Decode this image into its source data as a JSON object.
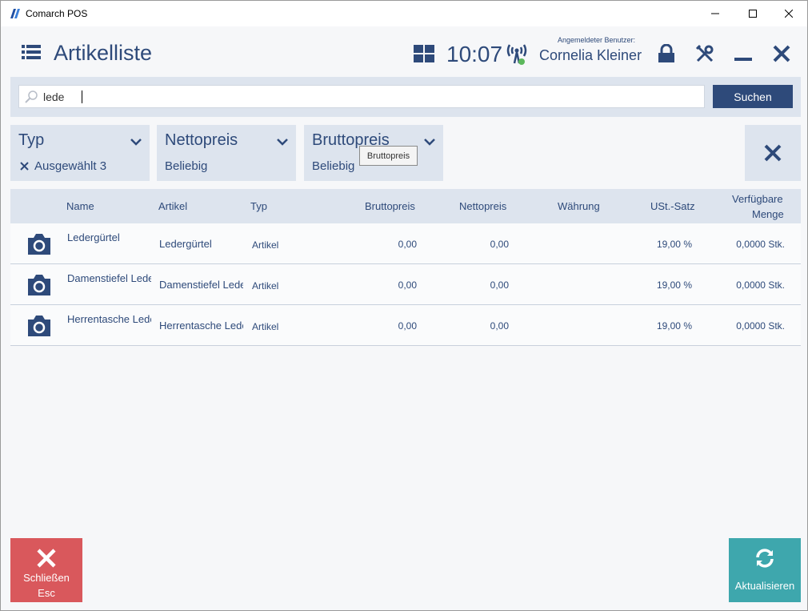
{
  "window": {
    "app_title": "Comarch POS"
  },
  "header": {
    "title": "Artikelliste",
    "clock": "10:07",
    "user_caption": "Angemeldeter Benutzer:",
    "user_name": "Cornelia Kleiner"
  },
  "search": {
    "value": "lede",
    "button_label": "Suchen"
  },
  "filters": [
    {
      "title": "Typ",
      "value": "Ausgewählt 3",
      "has_clear": true
    },
    {
      "title": "Nettopreis",
      "value": "Beliebig",
      "has_clear": false
    },
    {
      "title": "Bruttopreis",
      "value": "Beliebig",
      "has_clear": false
    }
  ],
  "tooltip": "Bruttopreis",
  "table": {
    "columns": {
      "name": "Name",
      "artikel": "Artikel",
      "typ": "Typ",
      "bruttopreis": "Bruttopreis",
      "nettopreis": "Nettopreis",
      "waehrung": "Währung",
      "ust": "USt.-Satz",
      "menge_line1": "Verfügbare",
      "menge_line2": "Menge"
    },
    "rows": [
      {
        "name": "Ledergürtel",
        "artikel": "Ledergürtel",
        "typ": "Artikel",
        "brutto": "0,00",
        "netto": "0,00",
        "waehrung": "",
        "ust": "19,00 %",
        "menge": "0,0000 Stk."
      },
      {
        "name": "Damenstiefel Leder",
        "artikel": "Damenstiefel Leder",
        "typ": "Artikel",
        "brutto": "0,00",
        "netto": "0,00",
        "waehrung": "",
        "ust": "19,00 %",
        "menge": "0,0000 Stk."
      },
      {
        "name": "Herrentasche Leder",
        "artikel": "Herrentasche Leder",
        "typ": "Artikel",
        "brutto": "0,00",
        "netto": "0,00",
        "waehrung": "",
        "ust": "19,00 %",
        "menge": "0,0000 Stk."
      }
    ]
  },
  "footer": {
    "close_label": "Schließen",
    "close_shortcut": "Esc",
    "refresh_label": "Aktualisieren"
  },
  "colors": {
    "primary": "#2e4a7a",
    "panel": "#dde4ee",
    "close": "#d9585c",
    "refresh": "#3ea7ad",
    "status_online": "#5cb85c"
  }
}
